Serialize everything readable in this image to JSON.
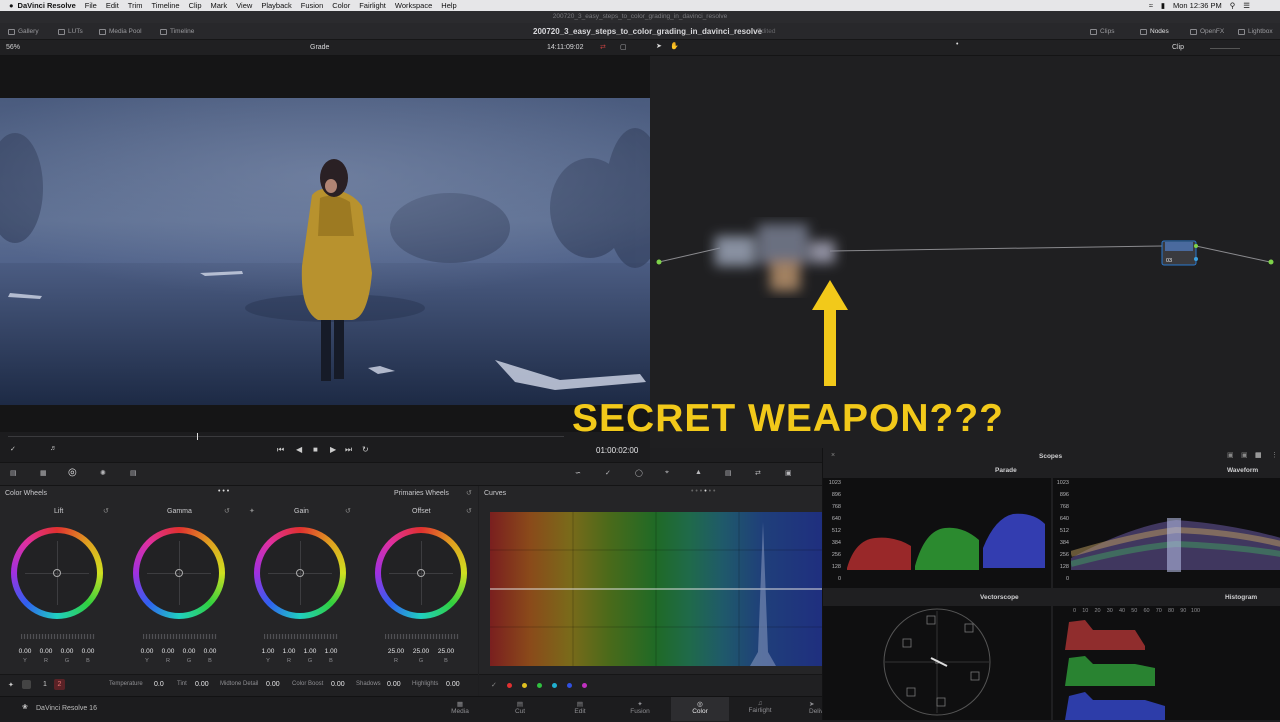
{
  "menubar": {
    "app": "DaVinci Resolve",
    "items": [
      "File",
      "Edit",
      "Trim",
      "Timeline",
      "Clip",
      "Mark",
      "View",
      "Playback",
      "Fusion",
      "Color",
      "Fairlight",
      "Workspace",
      "Help"
    ],
    "clock": "Mon 12:36 PM"
  },
  "window_title": "200720_3_easy_steps_to_color_grading_in_davinci_resolve",
  "topbar": {
    "gallery": "Gallery",
    "luts": "LUTs",
    "media_pool": "Media Pool",
    "timeline": "Timeline",
    "project_title": "200720_3_easy_steps_to_color_grading_in_davinci_resolve",
    "edited": "Edited",
    "clips": "Clips",
    "nodes": "Nodes",
    "openfx": "OpenFX",
    "lightbox": "Lightbox"
  },
  "viewer": {
    "zoom": "56%",
    "mode": "Grade",
    "timecode": "14:11:09:02",
    "playhead_tc": "01:00:02:00",
    "clip_mode": "Clip"
  },
  "node": {
    "label": "03"
  },
  "overlay": {
    "text": "SECRET WEAPON???",
    "color": "#f2c91a"
  },
  "color_wheels": {
    "title": "Color Wheels",
    "mode": "Primaries Wheels",
    "wheels": [
      {
        "name": "Lift",
        "values": [
          "0.00",
          "0.00",
          "0.00",
          "0.00"
        ]
      },
      {
        "name": "Gamma",
        "values": [
          "0.00",
          "0.00",
          "0.00",
          "0.00"
        ]
      },
      {
        "name": "Gain",
        "values": [
          "1.00",
          "1.00",
          "1.00",
          "1.00"
        ]
      },
      {
        "name": "Offset",
        "values": [
          "25.00",
          "25.00",
          "25.00"
        ]
      }
    ],
    "channels": [
      "Y",
      "R",
      "G",
      "B"
    ],
    "page_a": "1",
    "page_b": "2",
    "params": [
      {
        "label": "Temperature",
        "value": "0.0"
      },
      {
        "label": "Tint",
        "value": "0.00"
      },
      {
        "label": "Midtone Detail",
        "value": "0.00"
      },
      {
        "label": "Color Boost",
        "value": "0.00"
      },
      {
        "label": "Shadows",
        "value": "0.00"
      },
      {
        "label": "Highlights",
        "value": "0.00"
      }
    ]
  },
  "curves": {
    "title": "Curves"
  },
  "scopes": {
    "title": "Scopes",
    "parade": "Parade",
    "waveform": "Waveform",
    "vectorscope": "Vectorscope",
    "histogram": "Histogram",
    "ticks": [
      "1023",
      "896",
      "768",
      "640",
      "512",
      "384",
      "256",
      "128",
      "0"
    ],
    "hist_ticks": [
      "0",
      "10",
      "20",
      "30",
      "40",
      "50",
      "60",
      "70",
      "80",
      "90",
      "100"
    ]
  },
  "footer": {
    "brand": "DaVinci Resolve 16",
    "pages": [
      "Media",
      "Cut",
      "Edit",
      "Fusion",
      "Color",
      "Fairlight",
      "Deliver"
    ],
    "active_page": "Color"
  }
}
